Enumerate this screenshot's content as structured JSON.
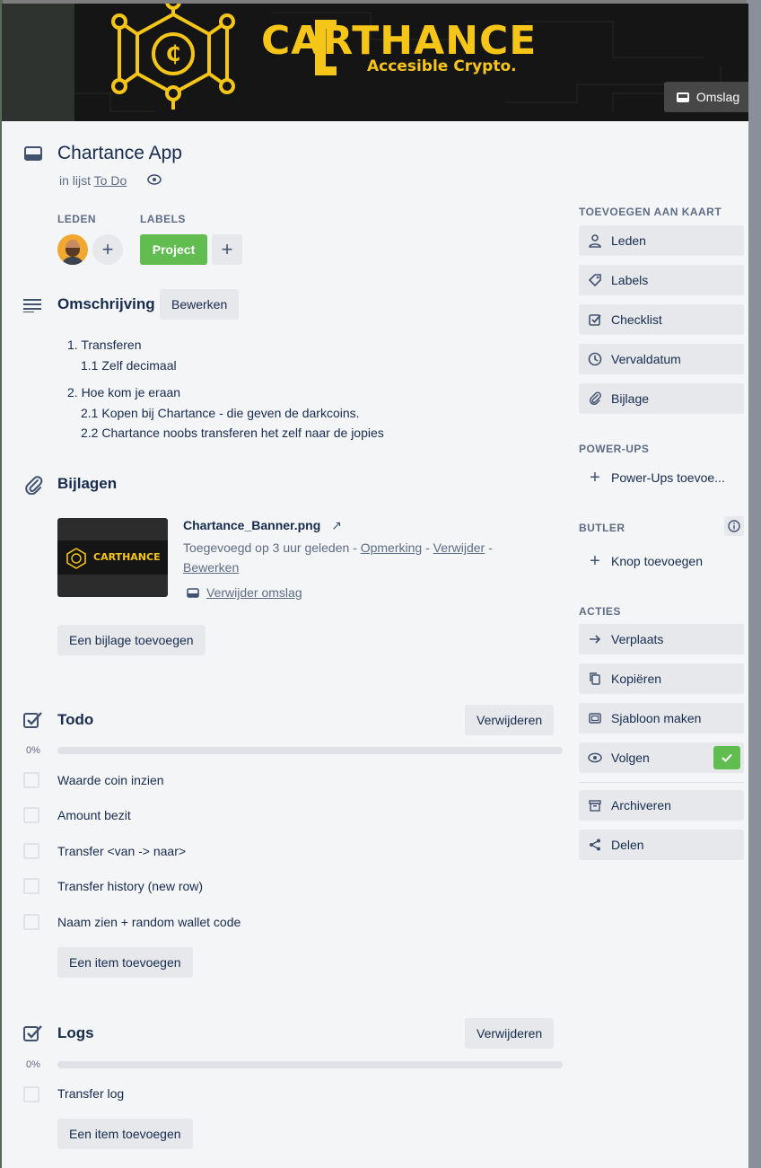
{
  "cover": {
    "brand_line1": "CARTHANCE",
    "brand_line2": "Accesible Crypto.",
    "cover_button": "Omslag"
  },
  "header": {
    "title": "Chartance App",
    "in_list_prefix": "in lijst",
    "list_name": "To Do"
  },
  "members": {
    "label": "LEDEN"
  },
  "labels": {
    "label": "LABELS",
    "items": [
      {
        "text": "Project",
        "color": "#61bd4f"
      }
    ]
  },
  "description": {
    "title": "Omschrijving",
    "edit_button": "Bewerken",
    "lines": [
      "1. Transferen",
      "1.1 Zelf decimaal",
      "2. Hoe kom je eraan",
      "2.1 Kopen bij Chartance - die geven de darkcoins.",
      "2.2 Chartance noobs transferen het zelf naar de jopies"
    ]
  },
  "attachments": {
    "title": "Bijlagen",
    "file_name": "Chartance_Banner.png",
    "added_text": "Toegevoegd op 3 uur geleden -",
    "comment_link": "Opmerking",
    "sep1": "-",
    "delete_link": "Verwijder",
    "sep2": "-",
    "edit_link": "Bewerken",
    "remove_cover_link": "Verwijder omslag",
    "thumb_brand": "CARTHANCE",
    "add_button": "Een bijlage toevoegen"
  },
  "checklists": [
    {
      "title": "Todo",
      "delete_button": "Verwijderen",
      "progress_text": "0%",
      "progress": 0,
      "items": [
        "Waarde coin inzien",
        "Amount bezit",
        "Transfer <van -> naar>",
        "Transfer history (new row)",
        "Naam zien + random wallet code"
      ],
      "add_button": "Een item toevoegen"
    },
    {
      "title": "Logs",
      "delete_button": "Verwijderen",
      "progress_text": "0%",
      "progress": 0,
      "items": [
        "Transfer log"
      ],
      "add_button": "Een item toevoegen"
    }
  ],
  "sidebar": {
    "add_to_card_title": "TOEVOEGEN AAN KAART",
    "add_to_card": [
      "Leden",
      "Labels",
      "Checklist",
      "Vervaldatum",
      "Bijlage"
    ],
    "powerups_title": "POWER-UPS",
    "powerups_add": "Power-Ups toevoe...",
    "butler_title": "BUTLER",
    "butler_add": "Knop toevoegen",
    "actions_title": "ACTIES",
    "actions": [
      "Verplaats",
      "Kopiëren",
      "Sjabloon maken",
      "Volgen",
      "Archiveren",
      "Delen"
    ]
  },
  "colors": {
    "label_green": "#61bd4f",
    "follow_check": "#61bd4f",
    "cover_gold": "#f5c518"
  }
}
